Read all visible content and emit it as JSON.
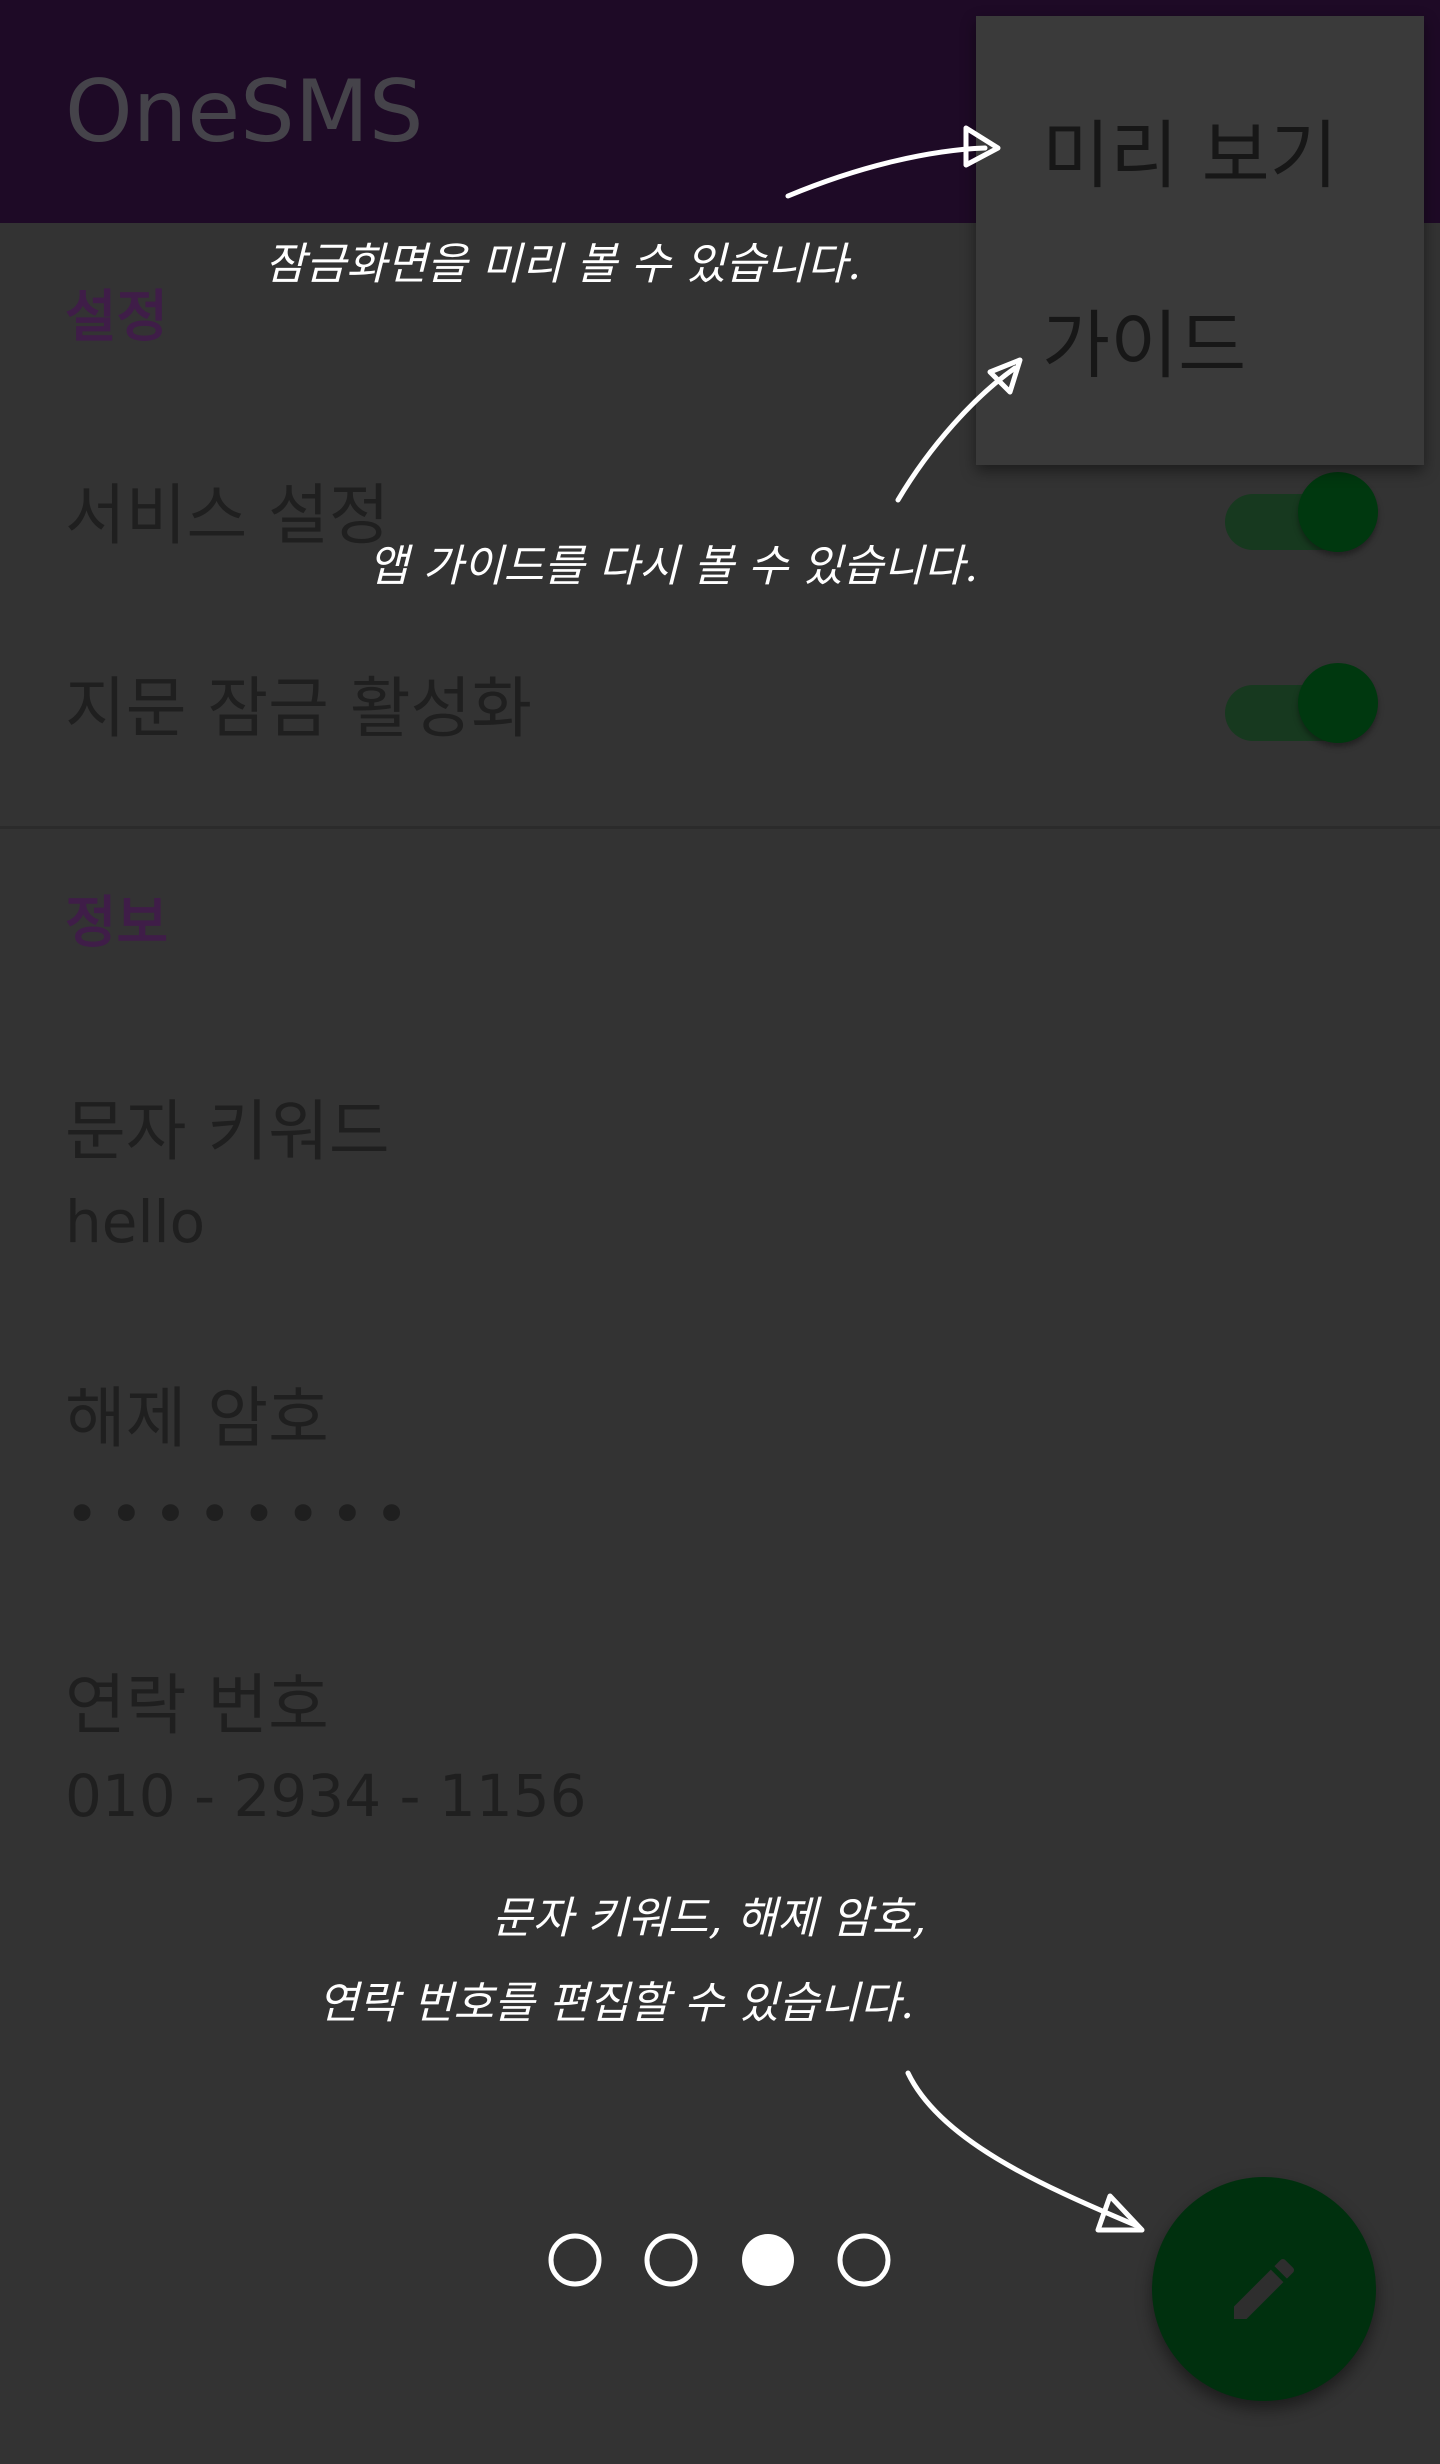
{
  "appbar": {
    "title": "OneSMS"
  },
  "overflow_menu": {
    "items": [
      {
        "label": "미리 보기"
      },
      {
        "label": "가이드"
      }
    ]
  },
  "settings": {
    "header": "설정",
    "service": {
      "title": "서비스 설정",
      "enabled": true
    },
    "fingerprint": {
      "title": "지문 잠금 활성화",
      "enabled": true
    }
  },
  "info": {
    "header": "정보",
    "keyword": {
      "title": "문자 키워드",
      "value": "hello"
    },
    "password": {
      "title": "해제 암호",
      "value": "••••••••"
    },
    "phone": {
      "title": "연락 번호",
      "value": "010 - 2934 - 1156"
    }
  },
  "guide": {
    "annotations": {
      "preview": "잠금화면을 미리 볼 수 있습니다.",
      "guide": "앱 가이드를 다시 볼 수 있습니다.",
      "edit_line1": "문자 키워드, 해제 암호,",
      "edit_line2": "연락 번호를 편집할 수 있습니다."
    },
    "page_indicator": {
      "total": 4,
      "current": 3
    }
  },
  "fab": {
    "icon": "pencil-icon"
  },
  "colors": {
    "scrim_background": "#333333",
    "appbar": "#1e0a26",
    "accent_header": "#3f1d48",
    "switch_on": "#00380f",
    "fab": "#00300e",
    "annotation_text": "#ffffff"
  }
}
